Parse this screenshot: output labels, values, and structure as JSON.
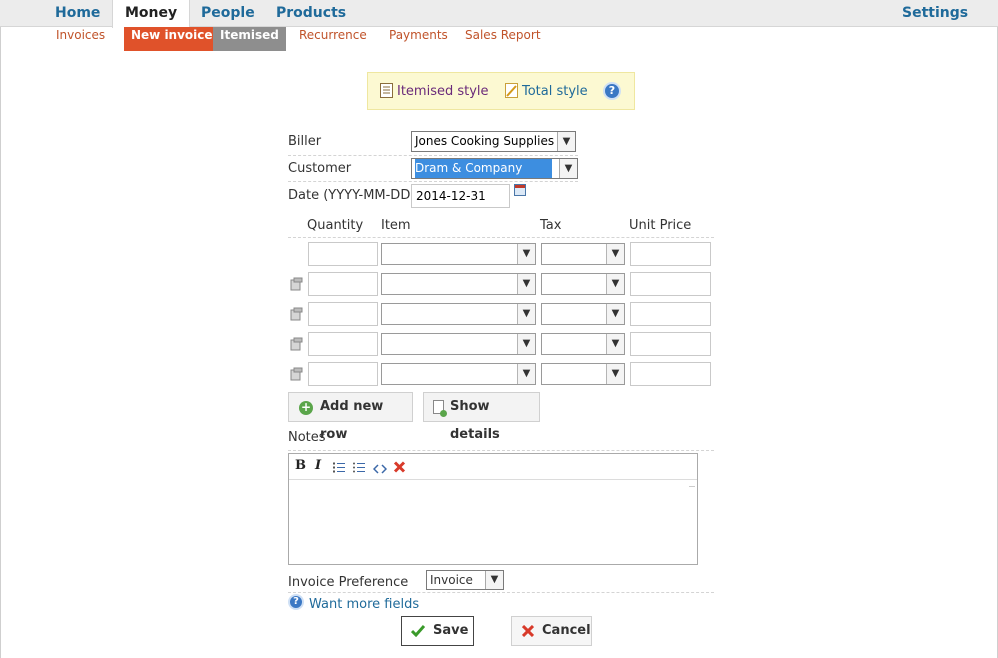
{
  "topnav": {
    "home": "Home",
    "money": "Money",
    "people": "People",
    "products": "Products",
    "settings": "Settings"
  },
  "subnav": {
    "invoices": "Invoices",
    "new_invoice": "New invoice",
    "itemised": "Itemised",
    "recurrence": "Recurrence",
    "payments": "Payments",
    "sales_report": "Sales Report"
  },
  "styles": {
    "itemised": "Itemised style",
    "total": "Total style"
  },
  "form": {
    "biller_label": "Biller",
    "biller_value": "Jones Cooking Supplies",
    "customer_label": "Customer",
    "customer_value": "Dram & Company",
    "date_label": "Date (YYYY-MM-DD)",
    "date_value": "2014-12-31"
  },
  "lines": {
    "headers": {
      "quantity": "Quantity",
      "item": "Item",
      "tax": "Tax",
      "unit_price": "Unit Price"
    }
  },
  "buttons": {
    "add_row": "Add new row",
    "show_details": "Show details",
    "save": "Save",
    "cancel": "Cancel"
  },
  "notes": {
    "label": "Notes",
    "toolbar": {
      "bold": "B",
      "italic": "I"
    }
  },
  "preference": {
    "label": "Invoice Preference",
    "value": "Invoice"
  },
  "more_fields": "Want more fields",
  "colors": {
    "link_blue": "#1f6a9a",
    "orange": "#e0522a",
    "grey_tab": "#8e8e8e",
    "highlight": "#3d8ee0",
    "style_box": "#fcf9d2"
  }
}
